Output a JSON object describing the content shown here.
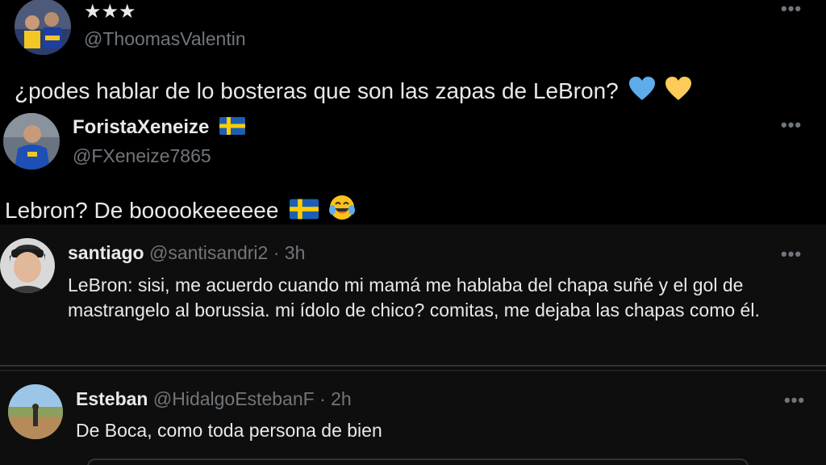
{
  "tweet1": {
    "display_name": "★★★",
    "handle": "@ThoomasValentin",
    "text": "¿podes hablar de lo bosteras que son las zapas de LeBron?",
    "emojis": [
      "blue-heart-icon",
      "yellow-heart-icon"
    ]
  },
  "tweet2": {
    "display_name": "ForistaXeneize",
    "handle": "@FXeneize7865",
    "text": "Lebron? De booookeeeeee",
    "emojis": [
      "sweden-flag-icon",
      "tears-of-joy-icon"
    ]
  },
  "replies": [
    {
      "display_name": "santiago",
      "handle": "@santisandri2",
      "separator": "·",
      "time": "3h",
      "text": "LeBron: sisi, me acuerdo cuando mi mamá me hablaba del chapa suñé y el gol de mastrangelo al borussia. mi ídolo de chico? comitas, me dejaba las chapas como él."
    },
    {
      "display_name": "Esteban",
      "handle": "@HidalgoEstebanF",
      "separator": "·",
      "time": "2h",
      "text": "De Boca, como toda persona de bien"
    }
  ],
  "more_label": "•••",
  "colors": {
    "background": "#000000",
    "reply_background": "#0e0e0e",
    "text": "#e7e9ea",
    "secondary_text": "#71767b",
    "divider": "#2f3336"
  }
}
